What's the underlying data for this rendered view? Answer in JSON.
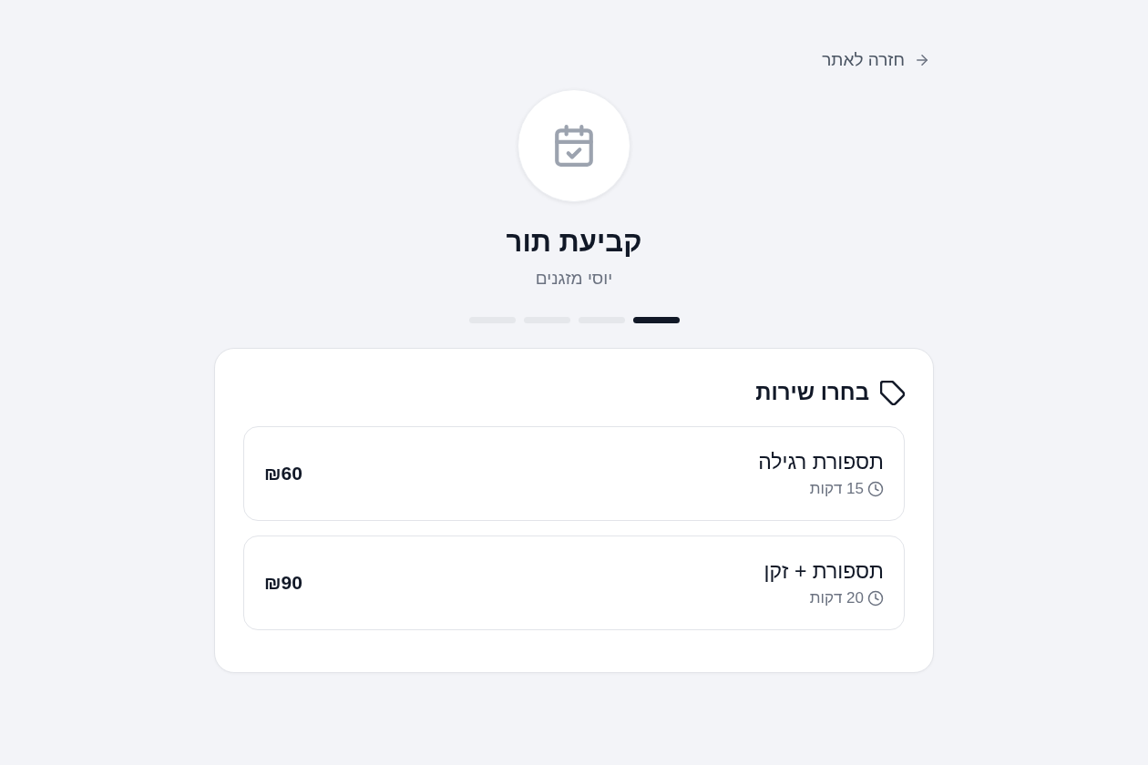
{
  "back_link": {
    "label": "חזרה לאתר"
  },
  "header": {
    "title": "קביעת תור",
    "subtitle": "יוסי מזגנים"
  },
  "steps": [
    {
      "active": true
    },
    {
      "active": false
    },
    {
      "active": false
    },
    {
      "active": false
    }
  ],
  "services_card": {
    "title": "בחרו שירות",
    "services": [
      {
        "name": "תספורת רגילה",
        "duration": "15 דקות",
        "price": "₪60"
      },
      {
        "name": "תספורת + זקן",
        "duration": "20 דקות",
        "price": "₪90"
      }
    ]
  }
}
